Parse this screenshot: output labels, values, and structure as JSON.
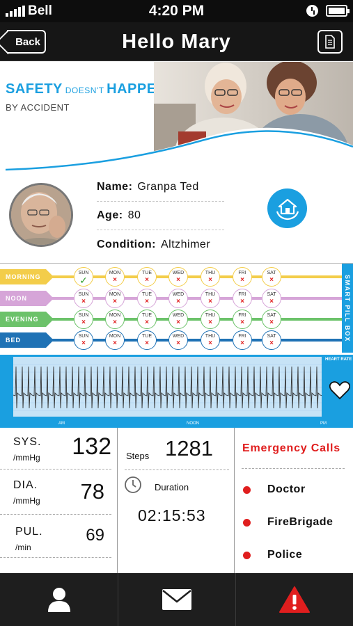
{
  "status_bar": {
    "carrier": "Bell",
    "time": "4:20 PM"
  },
  "nav": {
    "back_label": "Back",
    "title": "Hello Mary"
  },
  "banner": {
    "word1": "SAFETY",
    "word2": " DOESN'T ",
    "word3": "HAPPEN",
    "line2": "BY ACCIDENT"
  },
  "profile": {
    "name_label": "Name:",
    "name": "Granpa Ted",
    "age_label": "Age:",
    "age": "80",
    "condition_label": "Condition:",
    "condition": "Altzhimer"
  },
  "pill_box": {
    "side_label": "SMART PILL BOX",
    "days": [
      "SUN",
      "MON",
      "TUE",
      "WED",
      "THU",
      "FRI",
      "SAT"
    ],
    "rows": [
      {
        "label": "MORNING",
        "color": "#f3cd4a",
        "marks": [
          "✓",
          "×",
          "×",
          "×",
          "×",
          "×",
          "×"
        ]
      },
      {
        "label": "NOON",
        "color": "#d6a5d8",
        "marks": [
          "×",
          "×",
          "×",
          "×",
          "×",
          "×",
          "×"
        ]
      },
      {
        "label": "EVENING",
        "color": "#6cc26a",
        "marks": [
          "×",
          "×",
          "×",
          "×",
          "×",
          "×",
          "×"
        ]
      },
      {
        "label": "BED",
        "color": "#1f72b5",
        "marks": [
          "×",
          "×",
          "×",
          "×",
          "×",
          "×",
          "×"
        ]
      }
    ]
  },
  "heart_rate": {
    "label": "HEART RATE",
    "ticks": [
      "AM",
      "NOON",
      "PM"
    ]
  },
  "vitals": {
    "sys_label": "SYS.",
    "sys_unit": "/mmHg",
    "sys": "132",
    "dia_label": "DIA.",
    "dia_unit": "/mmHg",
    "dia": "78",
    "pul_label": "PUL.",
    "pul_unit": "/min",
    "pul": "69"
  },
  "activity": {
    "steps_label": "Steps",
    "steps": "1281",
    "duration_label": "Duration",
    "duration": "02:15:53"
  },
  "emergency": {
    "title": "Emergency Calls",
    "contacts": [
      "Doctor",
      "FireBrigade",
      "Police"
    ]
  },
  "colors": {
    "accent": "#1a9fe0",
    "alert": "#e01e1e"
  }
}
